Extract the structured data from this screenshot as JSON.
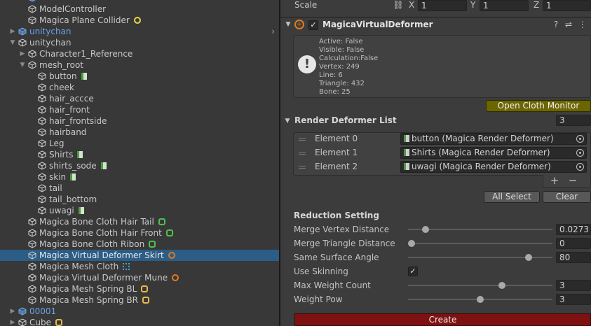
{
  "hierarchy": {
    "rows": [
      {
        "label": "",
        "folded": "open",
        "color": "blue"
      },
      {
        "label": "ModelController"
      },
      {
        "label": "Magica Plane Collider",
        "badge": "collider"
      },
      {
        "label": "unitychan",
        "folded": "closed",
        "color": "blue"
      },
      {
        "label": "unitychan",
        "folded": "open"
      },
      {
        "label": "Character1_Reference",
        "folded": "closed"
      },
      {
        "label": "mesh_root",
        "folded": "open"
      },
      {
        "label": "button",
        "badge": "render"
      },
      {
        "label": "cheek"
      },
      {
        "label": "hair_accce"
      },
      {
        "label": "hair_front"
      },
      {
        "label": "hair_frontside"
      },
      {
        "label": "hairband"
      },
      {
        "label": "Leg"
      },
      {
        "label": "Shirts",
        "badge": "render"
      },
      {
        "label": "shirts_sode",
        "badge": "render"
      },
      {
        "label": "skin",
        "badge": "render"
      },
      {
        "label": "tail"
      },
      {
        "label": "tail_bottom"
      },
      {
        "label": "uwagi",
        "badge": "render"
      },
      {
        "label": "Magica Bone Cloth Hair Tail",
        "badge": "bone"
      },
      {
        "label": "Magica Bone Cloth Hair Front",
        "badge": "bone"
      },
      {
        "label": "Magica Bone Cloth Ribon",
        "badge": "bone"
      },
      {
        "label": "Magica Virtual Deformer Skirt",
        "badge": "virtual",
        "selected": true
      },
      {
        "label": "Magica Mesh Cloth",
        "badge": "mesh"
      },
      {
        "label": "Magica Virtual Deformer Mune",
        "badge": "virtual"
      },
      {
        "label": "Magica Mesh Spring BL",
        "badge": "spring"
      },
      {
        "label": "Magica Mesh Spring BR",
        "badge": "spring"
      },
      {
        "label": "00001",
        "folded": "closed",
        "color": "blue"
      },
      {
        "label": "Cube",
        "folded": "closed",
        "badge": "spring"
      }
    ]
  },
  "inspector": {
    "scale": {
      "label": "Scale",
      "x_label": "X",
      "x": "1",
      "y_label": "Y",
      "y": "1",
      "z_label": "Z",
      "z": "1"
    },
    "component": {
      "title": "MagicaVirtualDeformer",
      "enabled": true
    },
    "monitor": [
      "Active: False",
      "Visible: False",
      "Calculation:False",
      "Vertex: 249",
      "Line: 6",
      "Triangle: 432",
      "Bone: 25"
    ],
    "open_monitor_label": "Open Cloth Monitor",
    "render_list": {
      "label": "Render Deformer List",
      "count": "3",
      "elements": [
        {
          "label": "Element 0",
          "value": "button (Magica Render Deformer)"
        },
        {
          "label": "Element 1",
          "value": "Shirts (Magica Render Deformer)"
        },
        {
          "label": "Element 2",
          "value": "uwagi (Magica Render Deformer)"
        }
      ],
      "plus": "+",
      "minus": "−"
    },
    "all_select_label": "All Select",
    "clear_label": "Clear",
    "reduction": {
      "title": "Reduction Setting",
      "merge_vertex": {
        "label": "Merge Vertex Distance",
        "value": "0.0273",
        "fraction": 0.1
      },
      "merge_triangle": {
        "label": "Merge Triangle Distance",
        "value": "0",
        "fraction": 0.0
      },
      "same_surface": {
        "label": "Same Surface Angle",
        "value": "80",
        "fraction": 0.85
      }
    },
    "use_skinning": {
      "label": "Use Skinning",
      "checked": true
    },
    "max_weight": {
      "label": "Max Weight Count",
      "value": "3",
      "fraction": 0.66
    },
    "weight_pow": {
      "label": "Weight Pow",
      "value": "3",
      "fraction": 0.5
    },
    "create_label": "Create"
  }
}
